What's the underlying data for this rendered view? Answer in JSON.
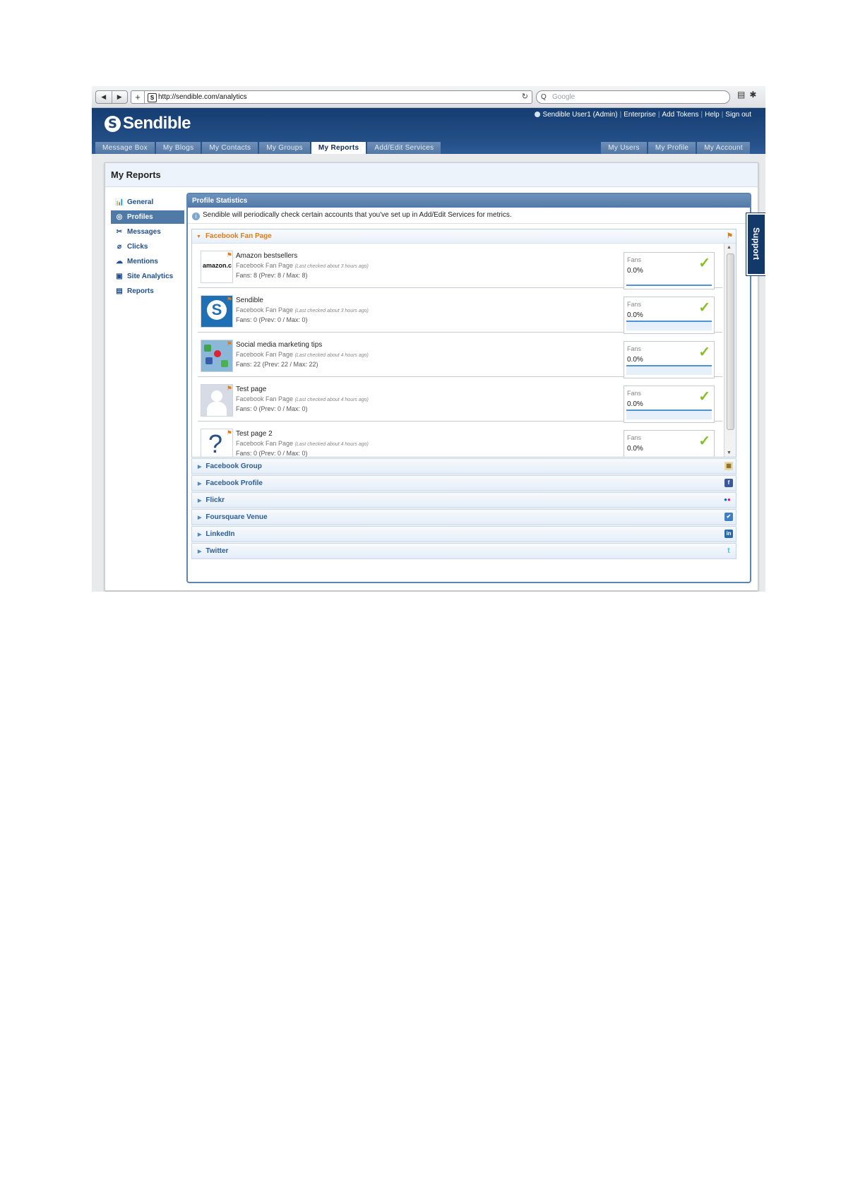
{
  "browser": {
    "back_glyph": "◀",
    "forward_glyph": "▶",
    "new_tab_glyph": "+",
    "favicon_glyph": "S",
    "url": "http://sendible.com/analytics",
    "reload_glyph": "↻",
    "search_glyph": "Q",
    "search_placeholder": "Google",
    "page_glyph": "▤",
    "gear_glyph": "✱"
  },
  "header": {
    "logo_mark": "S",
    "logo_text": "Sendible",
    "user": "Sendible User1 (Admin)",
    "links": [
      "Enterprise",
      "Add Tokens",
      "Help",
      "Sign out"
    ],
    "sep": "|"
  },
  "tabs_left": [
    "Message Box",
    "My Blogs",
    "My Contacts",
    "My Groups",
    "My Reports",
    "Add/Edit Services"
  ],
  "tabs_right": [
    "My Users",
    "My Profile",
    "My Account"
  ],
  "page_title": "My Reports",
  "sidebar": [
    {
      "label": "General",
      "icon": "📊"
    },
    {
      "label": "Profiles",
      "icon": "◎"
    },
    {
      "label": "Messages",
      "icon": "✂"
    },
    {
      "label": "Clicks",
      "icon": "⌀"
    },
    {
      "label": "Mentions",
      "icon": "☁"
    },
    {
      "label": "Site Analytics",
      "icon": "▣"
    },
    {
      "label": "Reports",
      "icon": "▤"
    }
  ],
  "stats": {
    "title": "Profile Statistics",
    "info_icon": "i",
    "info": "Sendible will periodically check certain accounts that you've set up in Add/Edit Services for metrics.",
    "section_title": "Facebook Fan Page",
    "section_expand_glyph": "▼",
    "section_flag_glyph": "⚑",
    "badge_glyph": "⚑",
    "check_glyph": "✓",
    "scroll_up": "▲",
    "scroll_down": "▼",
    "rows": [
      {
        "name": "Amazon bestsellers",
        "type": "Facebook Fan Page",
        "checked": "(Last checked about 3 hours ago)",
        "fans_text": "Fans: 8 (Prev: 8 / Max: 8)",
        "thumb": "amazon.c",
        "metric": "Fans",
        "pct": "0.0%"
      },
      {
        "name": "Sendible",
        "type": "Facebook Fan Page",
        "checked": "(Last checked about 3 hours ago)",
        "fans_text": "Fans: 0 (Prev: 0 / Max: 0)",
        "thumb": "S",
        "metric": "Fans",
        "pct": "0.0%"
      },
      {
        "name": "Social media marketing tips",
        "type": "Facebook Fan Page",
        "checked": "(Last checked about 4 hours ago)",
        "fans_text": "Fans: 22 (Prev: 22 / Max: 22)",
        "thumb": "",
        "metric": "Fans",
        "pct": "0.0%"
      },
      {
        "name": "Test page",
        "type": "Facebook Fan Page",
        "checked": "(Last checked about 4 hours ago)",
        "fans_text": "Fans: 0 (Prev: 0 / Max: 0)",
        "thumb": "",
        "metric": "Fans",
        "pct": "0.0%"
      },
      {
        "name": "Test page 2",
        "type": "Facebook Fan Page",
        "checked": "(Last checked about 4 hours ago)",
        "fans_text": "Fans: 0 (Prev: 0 / Max: 0)",
        "thumb": "?",
        "metric": "Fans",
        "pct": "0.0%"
      }
    ]
  },
  "services": [
    {
      "label": "Facebook Group",
      "icon": "▦",
      "color": "#d7b45a"
    },
    {
      "label": "Facebook Profile",
      "icon": "f",
      "color": "#3b5998"
    },
    {
      "label": "Flickr",
      "icon": "●●",
      "color": "#ffffff"
    },
    {
      "label": "Foursquare Venue",
      "icon": "✔",
      "color": "#3e7fc2"
    },
    {
      "label": "LinkedIn",
      "icon": "in",
      "color": "#2a6aa5"
    },
    {
      "label": "Twitter",
      "icon": "t",
      "color": "#ffffff"
    }
  ],
  "support_label": "Support",
  "colors": {
    "accent": "#e07b16",
    "brand": "#1b4679",
    "check": "#86be28"
  }
}
